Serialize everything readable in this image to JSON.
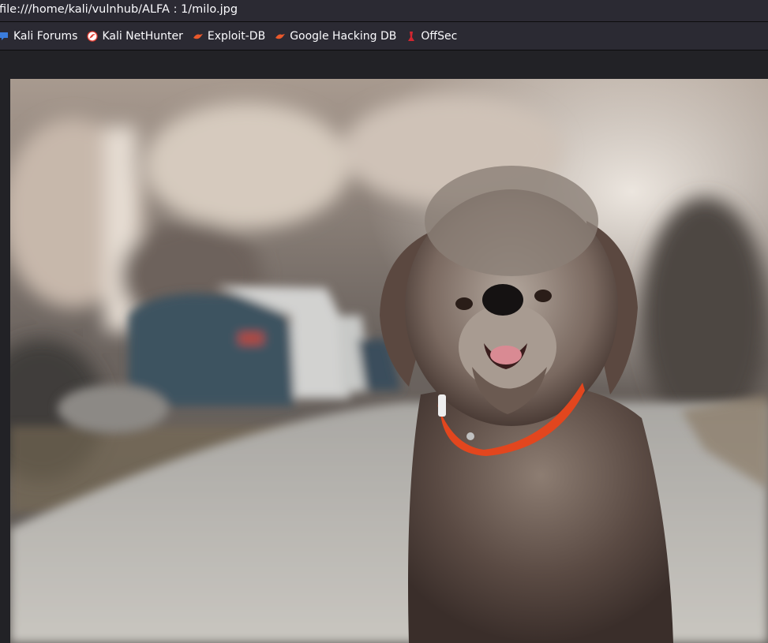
{
  "address": {
    "url": "file:///home/kali/vulnhub/ALFA : 1/milo.jpg"
  },
  "bookmarks": [
    {
      "label": "Kali Forums",
      "icon": "kali-forums-icon",
      "color": "#3b7ddd"
    },
    {
      "label": "Kali NetHunter",
      "icon": "kali-nethunter-icon",
      "color": "#e03c31"
    },
    {
      "label": "Exploit-DB",
      "icon": "exploit-db-icon",
      "color": "#e8582b"
    },
    {
      "label": "Google Hacking DB",
      "icon": "google-hacking-db-icon",
      "color": "#e8582b"
    },
    {
      "label": "OffSec",
      "icon": "offsec-icon",
      "color": "#d22630"
    }
  ],
  "image": {
    "subject": "dog-photo",
    "collar_color": "#e2461e"
  }
}
